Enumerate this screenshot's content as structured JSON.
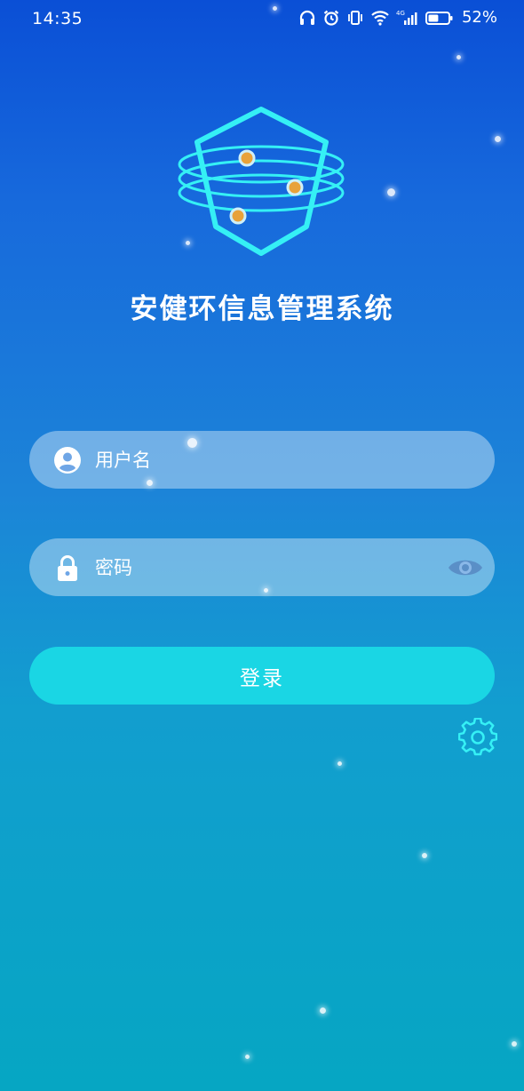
{
  "status_bar": {
    "time": "14:35",
    "network_label": "4G",
    "battery_percent": "52%",
    "battery_level": 0.52,
    "icons": [
      "headphones-icon",
      "alarm-icon",
      "vibrate-icon",
      "wifi-icon",
      "signal-icon",
      "battery-icon"
    ]
  },
  "app": {
    "title": "安健环信息管理系统",
    "logo_icon": "hexagon-globe-logo"
  },
  "login_form": {
    "username": {
      "placeholder": "用户名",
      "value": "",
      "icon": "user-icon"
    },
    "password": {
      "placeholder": "密码",
      "value": "",
      "icon": "lock-icon",
      "toggle_icon": "eye-icon"
    },
    "login_label": "登录",
    "settings_icon": "gear-icon"
  },
  "colors": {
    "background_top": "#0a4fd6",
    "background_bottom": "#06a6c3",
    "button": "#1ad6e4",
    "accent_cyan": "#35f0f5",
    "logo_dot": "#e8a23a"
  }
}
